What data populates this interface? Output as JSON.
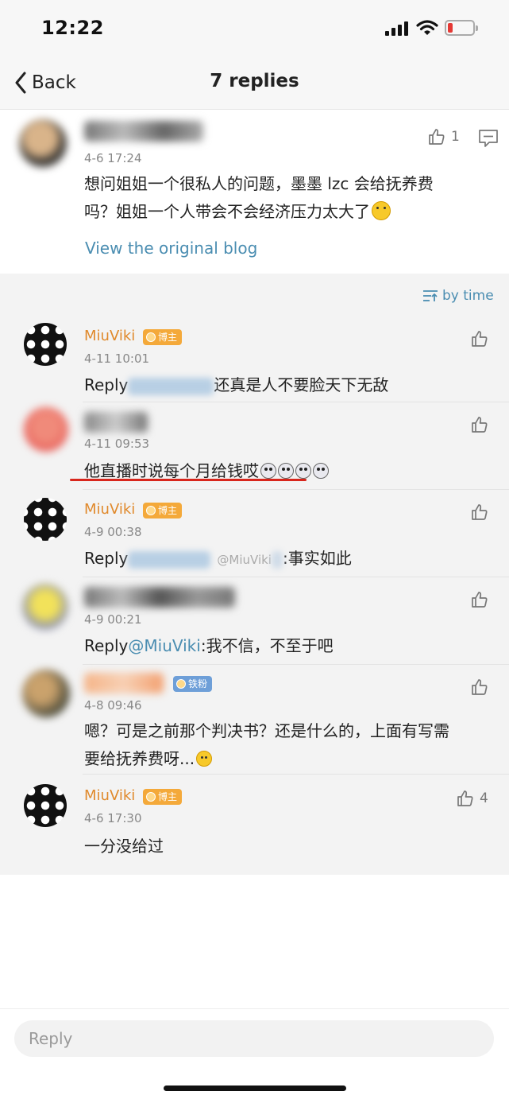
{
  "status_bar": {
    "time": "12:22"
  },
  "nav": {
    "back_label": "Back",
    "title": "7 replies"
  },
  "root_comment": {
    "timestamp": "4-6 17:24",
    "like_count": "1",
    "text_line1": "想问姐姐一个很私人的问题，墨墨 lzc 会给抚养费",
    "text_line2": "吗？姐姐一个人带会不会经济压力太大了",
    "view_blog_link": "View the original blog"
  },
  "sort_label": "by time",
  "replies": [
    {
      "username": "MiuViki",
      "badge": "博主",
      "timestamp": "4-11 10:01",
      "prefix": "Reply",
      "text": "还真是人不要脸天下无敌"
    },
    {
      "username": "",
      "timestamp": "4-11 09:53",
      "text": "他直播时说每个月给钱哎"
    },
    {
      "username": "MiuViki",
      "badge": "博主",
      "timestamp": "4-9 00:38",
      "prefix": "Reply",
      "inline_mention": "@MiuViki",
      "text": ":事实如此"
    },
    {
      "username": "",
      "timestamp": "4-9 00:21",
      "prefix": "Reply",
      "mention": "@MiuViki",
      "text": ":我不信，不至于吧"
    },
    {
      "username": "",
      "badge": "铁粉",
      "timestamp": "4-8 09:46",
      "text_line1": "嗯？可是之前那个判决书？还是什么的，上面有写需",
      "text_line2": "要给抚养费呀..."
    },
    {
      "username": "MiuViki",
      "badge": "博主",
      "timestamp": "4-6 17:30",
      "like_count": "4",
      "text": "一分没给过"
    }
  ],
  "reply_input": {
    "placeholder": "Reply"
  },
  "icons": {
    "back": "chevron-left-icon",
    "like": "thumbs-up-icon",
    "comment": "comment-icon",
    "sort": "sort-icon",
    "signal": "signal-icon",
    "wifi": "wifi-icon",
    "battery": "battery-icon"
  },
  "colors": {
    "username": "#e0892b",
    "link": "#4a8db1",
    "underline": "#d8261c",
    "badge_blogger": "#f4a93a",
    "badge_fan": "#6e9fd8"
  }
}
